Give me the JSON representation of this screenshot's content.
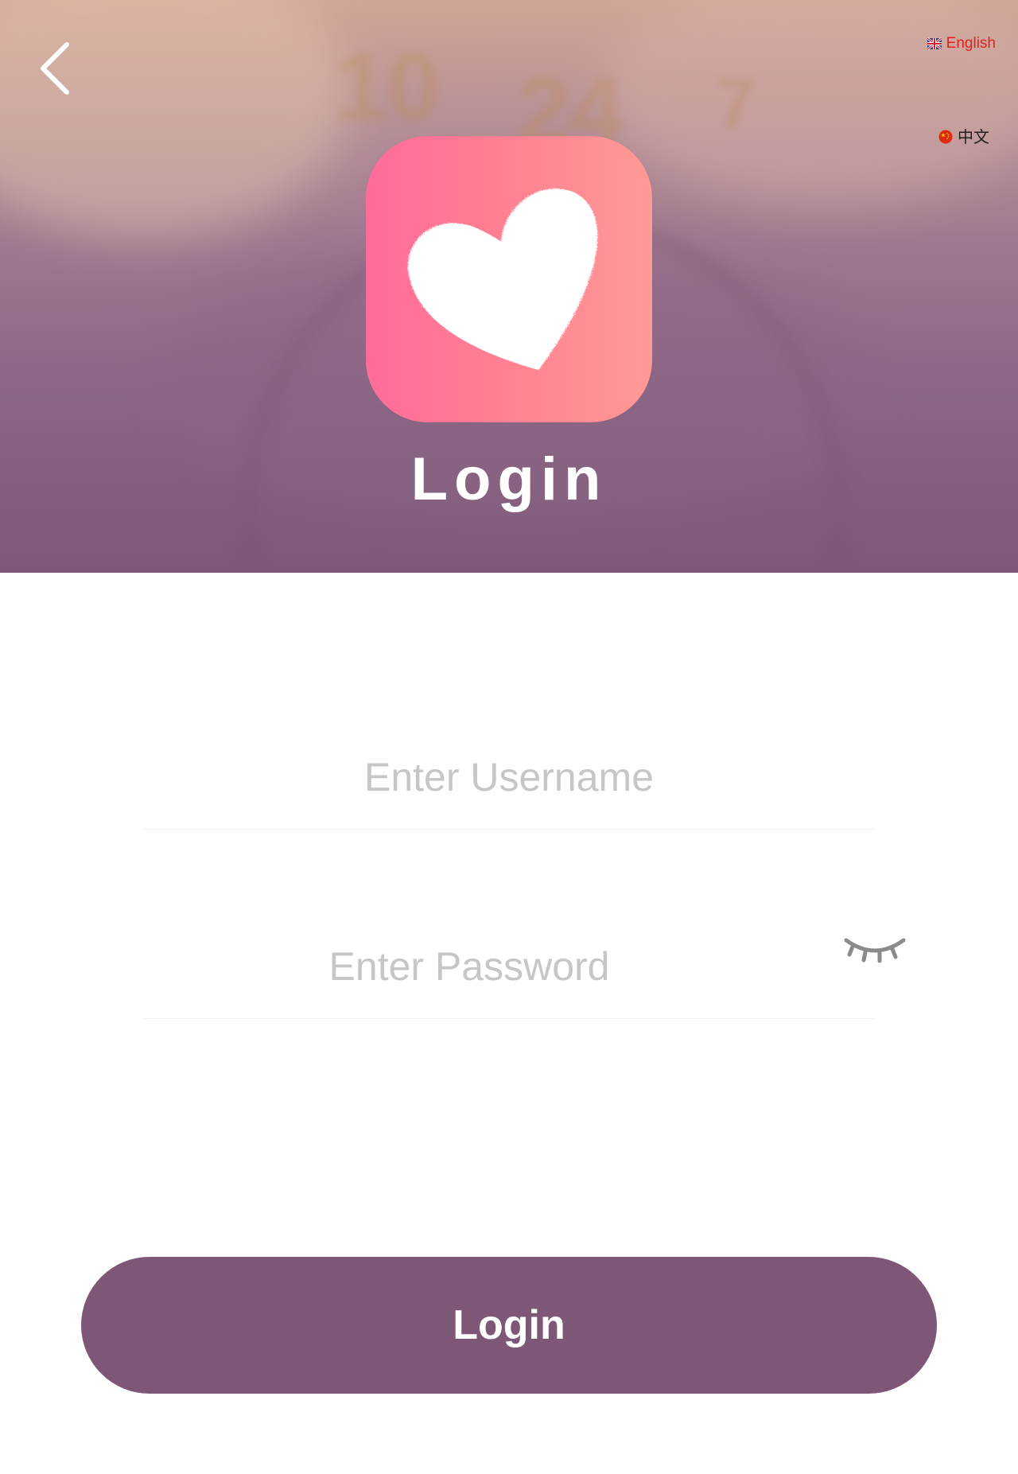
{
  "header": {
    "title": "Login",
    "back_icon": "chevron-left-icon",
    "app_logo_icon": "heart-icon",
    "languages": [
      {
        "label": "English",
        "flag": "uk-flag-icon",
        "active": true,
        "color": "#e0231d"
      },
      {
        "label": "中文",
        "flag": "china-flag-icon",
        "active": false,
        "color": "#1f1f1f"
      }
    ]
  },
  "form": {
    "username": {
      "placeholder": "Enter Username",
      "value": ""
    },
    "password": {
      "placeholder": "Enter Password",
      "value": "",
      "toggle_icon": "eye-closed-icon"
    },
    "submit_label": "Login"
  },
  "colors": {
    "accent": "#7e5777",
    "logo_gradient_start": "#ff6b9a",
    "logo_gradient_end": "#ff9a96",
    "placeholder": "#c6c6c8",
    "active_language": "#e0231d"
  }
}
